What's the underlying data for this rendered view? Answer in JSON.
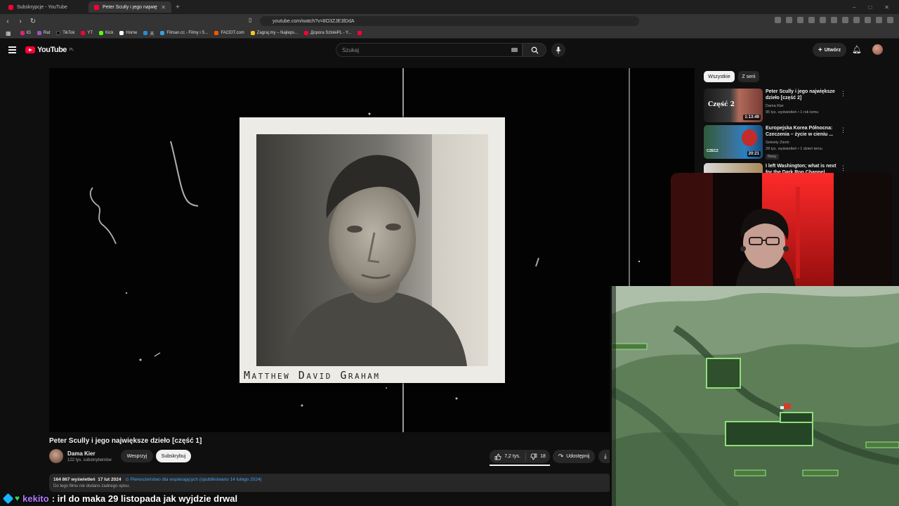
{
  "browser": {
    "tabs": [
      {
        "label": "Subskrypcje - YouTube",
        "active": false
      },
      {
        "label": "Peter Scully i jego największ",
        "active": true
      }
    ],
    "new_tab": "+",
    "window_controls": [
      "–",
      "□",
      "✕"
    ],
    "url": "youtube.com/watch?v=8O3ZJE3lDdA",
    "bookmarks": [
      "IG",
      "Rat",
      "TikTok",
      "YT",
      "Kick",
      "Home",
      "天",
      "Filman.cc - Filmy i S...",
      "FACEIT.com",
      "Zagraj.my – Najleps...",
      "Дорога SzlolePL - Y..."
    ]
  },
  "youtube": {
    "logo_text": "YouTube",
    "logo_region": "PL",
    "search_placeholder": "Szukaj",
    "create_label": "Utwórz",
    "video": {
      "title": "Peter Scully i jego największe dzieło [część 1]",
      "caption": "Matthew David Graham",
      "channel_name": "Dama Kier",
      "channel_subs": "122 tys. subskrybentów",
      "support_label": "Wesprzyj",
      "subscribe_label": "Subskrybuj",
      "likes": "7,2 tys.",
      "dislikes": "18",
      "share_label": "Udostępnij",
      "views": "164 867 wyświetleń",
      "date": "17 lut 2024",
      "priority_note": "⊙ Pierwszeństwo dla wspierających (opublikowano 14 lutego 2024)",
      "no_description": "Do tego filmu nie dodano żadnego opisu."
    },
    "chips": [
      "Wszystkie",
      "Z serii"
    ],
    "recommendations": [
      {
        "title": "Peter Scully i jego największe dzieło [część 2]",
        "thumb_text": "Część 2",
        "duration": "1:13:49",
        "channel": "Dama Kier",
        "meta": "95 tys. wyświetleń • 1 rok temu",
        "badge": ""
      },
      {
        "title": "Europejska Korea Północna: Czeczenia – życie w cieniu ...",
        "thumb_text": "CZECZ",
        "duration": "20:21",
        "channel": "Sekrety Ziemi",
        "meta": "28 tys. wyświetleń • 1 dzień temu",
        "badge": "Nowy"
      },
      {
        "title": "I left Washington; what is next for the Dark Ron Channel",
        "thumb_text": "",
        "duration": "",
        "channel": "",
        "meta": "",
        "badge": ""
      }
    ]
  },
  "chat": {
    "username": "kekito",
    "message": ": irl do maka 29 listopada jak wyjdzie drwal"
  },
  "colors": {
    "background": "#0f0f0f",
    "brand_red": "#ff0033",
    "link_blue": "#3ea6ff",
    "chat_user": "#b57cff"
  }
}
